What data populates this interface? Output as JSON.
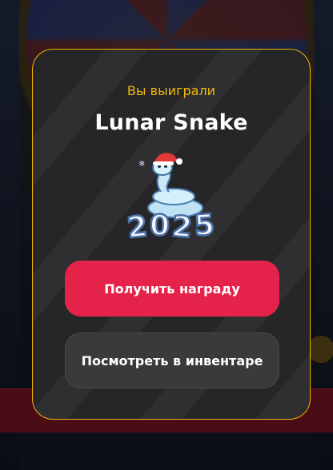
{
  "modal": {
    "subtitle": "Вы выиграли",
    "prize_name": "Lunar Snake",
    "prize_image": "snake-2025-sticker"
  },
  "buttons": {
    "claim_label": "Получить награду",
    "inventory_label": "Посмотреть в инвентаре"
  },
  "colors": {
    "accent_gold": "#f2b705",
    "claim_button": "#e5234a",
    "secondary_button": "#3a3a3d",
    "modal_background": "#262628"
  }
}
